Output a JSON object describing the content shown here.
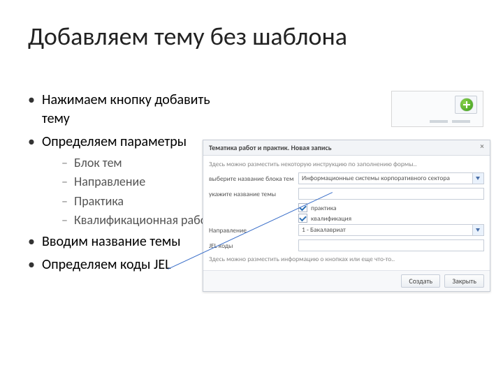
{
  "title": "Добавляем тему без шаблона",
  "bullets": {
    "b1": "Нажимаем кнопку добавить тему",
    "b2": "Определяем параметры",
    "b2s": {
      "s1": "Блок тем",
      "s2": "Направление",
      "s3": "Практика",
      "s4": "Квалификационная работа"
    },
    "b3": "Вводим название темы",
    "b4": "Определяем коды JEL"
  },
  "dialog": {
    "title": "Тематика работ и практик. Новая запись",
    "close": "×",
    "hint_top": "Здесь можно разместить некоторую инструкцию по заполнению формы..",
    "lbl_block": "выберите название блока тем",
    "val_block": "Информационные системы корпоративного сектора",
    "lbl_topic": "укажите название темы",
    "chk_practice": "практика",
    "chk_qualification": "квалификация",
    "lbl_direction": "Направление",
    "val_direction": "1 - Бакалавриат",
    "lbl_jel": "JEL коды",
    "hint_bottom": "Здесь можно разместить информацию о кнопках или еще что-то..",
    "btn_create": "Создать",
    "btn_close": "Закрыть"
  }
}
